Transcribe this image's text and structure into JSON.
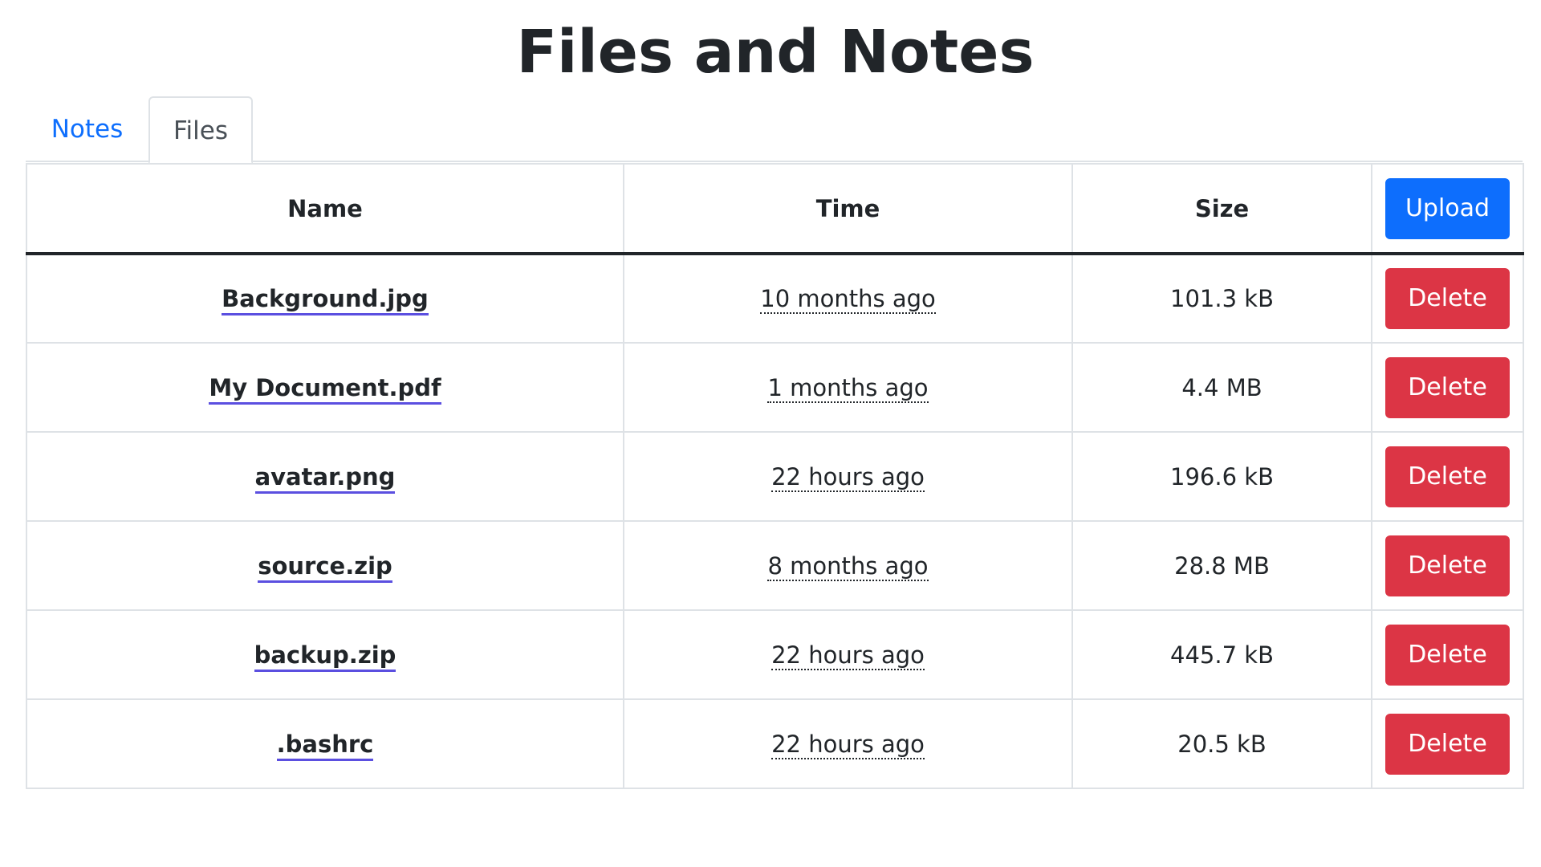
{
  "title": "Files and Notes",
  "tabs": [
    {
      "label": "Notes",
      "active": false
    },
    {
      "label": "Files",
      "active": true
    }
  ],
  "table": {
    "headers": {
      "name": "Name",
      "time": "Time",
      "size": "Size",
      "upload_label": "Upload"
    },
    "delete_label": "Delete",
    "rows": [
      {
        "name": "Background.jpg",
        "time": "10 months ago",
        "size": "101.3 kB"
      },
      {
        "name": "My Document.pdf",
        "time": "1 months ago",
        "size": "4.4 MB"
      },
      {
        "name": "avatar.png",
        "time": "22 hours ago",
        "size": "196.6 kB"
      },
      {
        "name": "source.zip",
        "time": "8 months ago",
        "size": "28.8 MB"
      },
      {
        "name": "backup.zip",
        "time": "22 hours ago",
        "size": "445.7 kB"
      },
      {
        "name": ".bashrc",
        "time": "22 hours ago",
        "size": "20.5 kB"
      }
    ]
  },
  "colors": {
    "primary": "#0d6efd",
    "danger": "#dc3545",
    "text": "#212529",
    "link_underline": "#5b4fe0",
    "border": "#dee2e6"
  }
}
